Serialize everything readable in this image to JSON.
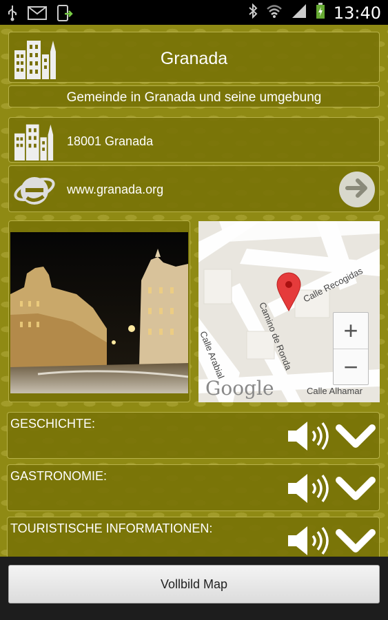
{
  "status_bar": {
    "time": "13:40",
    "icons": [
      "usb-icon",
      "email-icon",
      "download-icon",
      "bluetooth-icon",
      "wifi-icon",
      "signal-icon",
      "battery-icon"
    ]
  },
  "header": {
    "title": "Granada",
    "icon": "buildings-icon"
  },
  "subtitle": "Gemeinde in Granada und seine umgebung",
  "address": {
    "text": "18001 Granada",
    "icon": "buildings-icon"
  },
  "website": {
    "text": "www.granada.org",
    "icon": "browser-icon",
    "action_icon": "arrow-right-icon"
  },
  "map": {
    "streets": [
      "Calle Recogidas",
      "Camino de Ronda",
      "Calle Arabial",
      "Calle Alhamar"
    ],
    "logo": "Google",
    "zoom_in": "+",
    "zoom_out": "−"
  },
  "sections": [
    {
      "label": "GESCHICHTE:"
    },
    {
      "label": "GASTRONOMIE:"
    },
    {
      "label": "TOURISTISCHE INFORMATIONEN:"
    }
  ],
  "fullscreen_button": "Vollbild Map"
}
